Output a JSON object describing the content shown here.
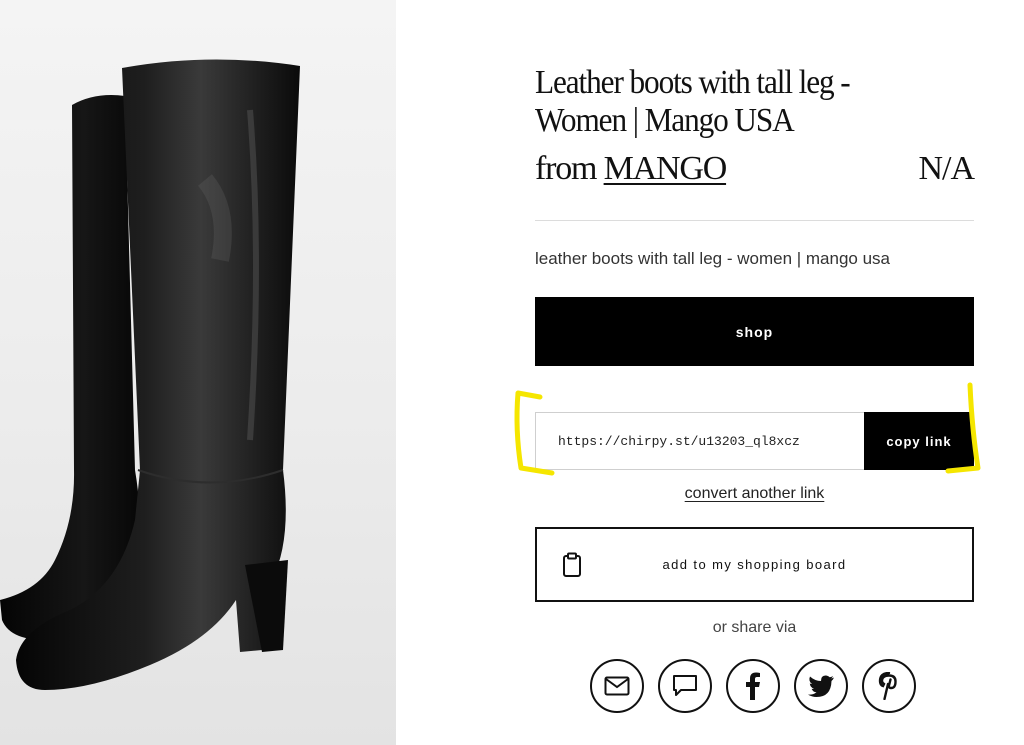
{
  "product": {
    "title": "Leather boots with tall leg - Women | Mango USA",
    "from_prefix": "from",
    "brand": "MANGO",
    "price": "N/A",
    "description": "leather boots with tall leg - women | mango usa"
  },
  "image": {
    "alt": "black leather knee-high boots with block heel"
  },
  "actions": {
    "shop_label": "shop",
    "link_value": "https://chirpy.st/u13203_ql8xcz",
    "copy_label": "copy link",
    "convert_label": "convert another link",
    "board_label": "add to my shopping board"
  },
  "share": {
    "label": "or share via",
    "icons": [
      "mail-icon",
      "message-icon",
      "facebook-icon",
      "twitter-icon",
      "pinterest-icon"
    ]
  },
  "colors": {
    "primary": "#000000",
    "highlight": "#f5e600",
    "background": "#ffffff"
  }
}
